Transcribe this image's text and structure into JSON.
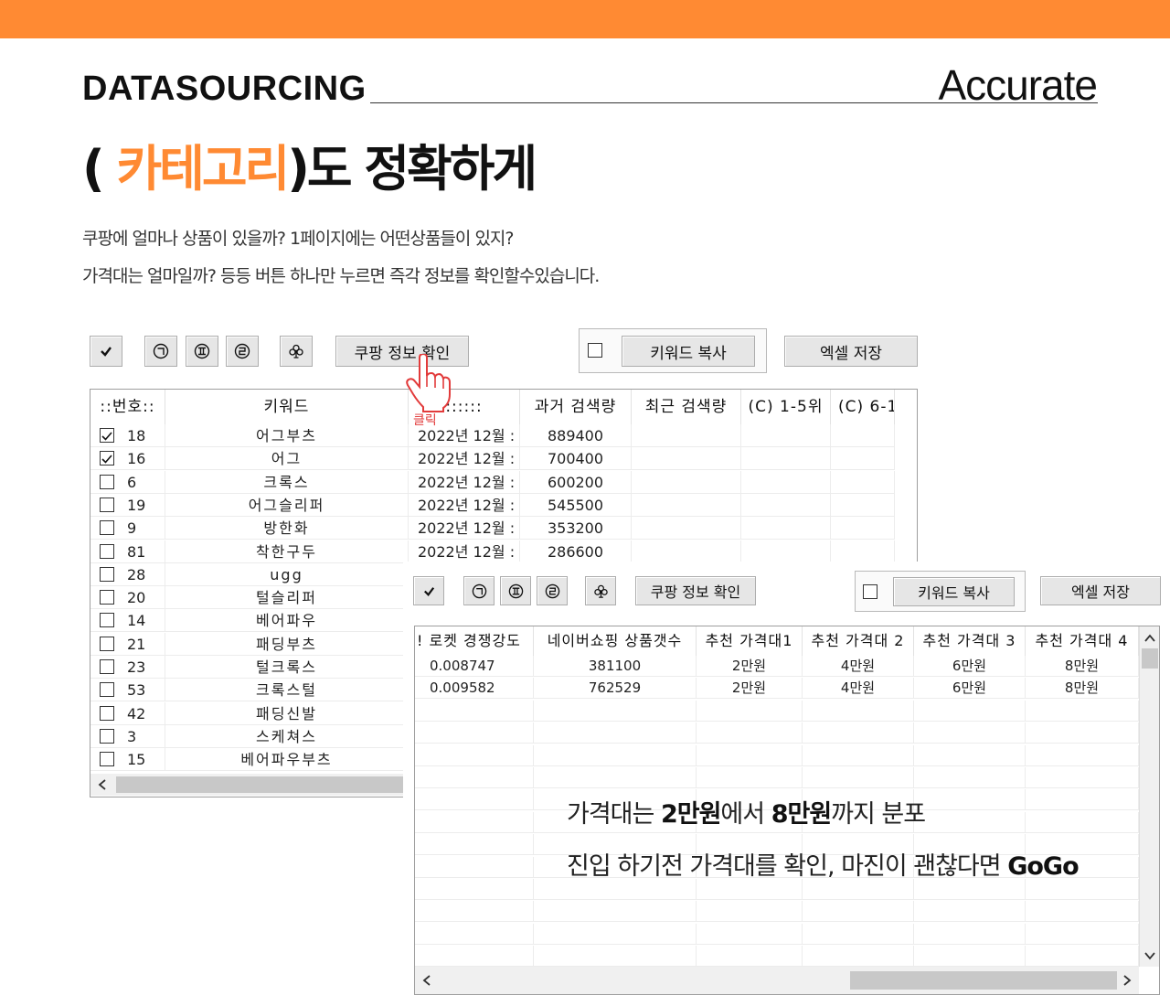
{
  "header": {
    "accent_color": "#ff8a33",
    "brand": "DATASOURCING",
    "tagline": "Accurate"
  },
  "headline": {
    "open_paren": "( ",
    "highlight": "카테고리",
    "rest": ")도 정확하게"
  },
  "description": {
    "line1": "쿠팡에 얼마나 상품이 있을까? 1페이지에는 어떤상품들이 있지?",
    "line2": "가격대는 얼마일까? 등등 버튼 하나만 누르면 즉각 정보를 확인할수있습니다."
  },
  "toolbar": {
    "icons": [
      "check-icon",
      "circled-giyeok-icon",
      "circled-roman-two-icon",
      "circled-rieul-icon",
      "club-icon"
    ],
    "coupang_info_button": "쿠팡 정보 확인",
    "keyword_copy_button": "키워드 복사",
    "excel_save_button": "엑셀 저장"
  },
  "click_label": "클릭",
  "grid1": {
    "columns": [
      "::번호::",
      "키워드",
      "::::::",
      "과거 검색량",
      "최근 검색량",
      "(C) 1-5위",
      "(C) 6-1"
    ],
    "rows": [
      {
        "checked": true,
        "no": "18",
        "keyword": "어그부츠",
        "date": "2022년 12월 :",
        "past": "889400"
      },
      {
        "checked": true,
        "no": "16",
        "keyword": "어그",
        "date": "2022년 12월 :",
        "past": "700400"
      },
      {
        "checked": false,
        "no": "6",
        "keyword": "크록스",
        "date": "2022년 12월 :",
        "past": "600200"
      },
      {
        "checked": false,
        "no": "19",
        "keyword": "어그슬리퍼",
        "date": "2022년 12월 :",
        "past": "545500"
      },
      {
        "checked": false,
        "no": "9",
        "keyword": "방한화",
        "date": "2022년 12월 :",
        "past": "353200"
      },
      {
        "checked": false,
        "no": "81",
        "keyword": "착한구두",
        "date": "2022년 12월 :",
        "past": "286600"
      },
      {
        "checked": false,
        "no": "28",
        "keyword": "ugg",
        "date": "",
        "past": ""
      },
      {
        "checked": false,
        "no": "20",
        "keyword": "털슬리퍼",
        "date": "",
        "past": ""
      },
      {
        "checked": false,
        "no": "14",
        "keyword": "베어파우",
        "date": "",
        "past": ""
      },
      {
        "checked": false,
        "no": "21",
        "keyword": "패딩부츠",
        "date": "",
        "past": ""
      },
      {
        "checked": false,
        "no": "23",
        "keyword": "털크록스",
        "date": "",
        "past": ""
      },
      {
        "checked": false,
        "no": "53",
        "keyword": "크록스털",
        "date": "",
        "past": ""
      },
      {
        "checked": false,
        "no": "42",
        "keyword": "패딩신발",
        "date": "",
        "past": ""
      },
      {
        "checked": false,
        "no": "3",
        "keyword": "스케쳐스",
        "date": "",
        "past": ""
      },
      {
        "checked": false,
        "no": "15",
        "keyword": "베어파우부츠",
        "date": "",
        "past": ""
      }
    ]
  },
  "grid2": {
    "columns": [
      "! 로켓 경쟁강도",
      "네이버쇼핑 상품갯수",
      "추천 가격대1",
      "추천 가격대 2",
      "추천 가격대 3",
      "추천 가격대 4"
    ],
    "rows": [
      [
        "0.008747",
        "381100",
        "2만원",
        "4만원",
        "6만원",
        "8만원"
      ],
      [
        "0.009582",
        "762529",
        "2만원",
        "4만원",
        "6만원",
        "8만원"
      ]
    ]
  },
  "note": {
    "line1_a": "가격대는 ",
    "line1_b": "2만원",
    "line1_c": "에서 ",
    "line1_d": "8만원",
    "line1_e": "까지 분포",
    "line2_a": "진입 하기전 가격대를 확인, 마진이 괜찮다면 ",
    "line2_b": "GoGo"
  }
}
